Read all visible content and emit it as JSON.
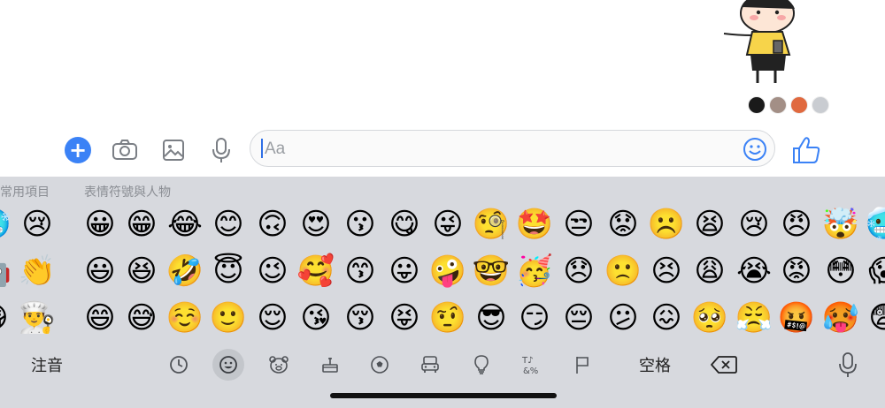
{
  "composer": {
    "placeholder": "Aa"
  },
  "keyboard": {
    "categories": [
      "常用項目",
      "表情符號與人物"
    ],
    "left_toggle": "注音",
    "space_label": "空格",
    "tabs": [
      "recent-clock-icon",
      "smileys-icon",
      "animals-icon",
      "food-icon",
      "activity-icon",
      "travel-icon",
      "objects-icon",
      "symbols-icon",
      "flags-icon"
    ],
    "frequent_rows": [
      [
        "😢"
      ],
      [
        "👏"
      ],
      [
        "👨‍🍳"
      ]
    ],
    "emoji_rows": [
      [
        "😀",
        "😁",
        "😂",
        "😊",
        "🙃",
        "😍",
        "😗",
        "😋",
        "😜",
        "🧐",
        "🤩",
        "😒",
        "😟",
        "☹️",
        "😫",
        "😢",
        "😠",
        "🤯",
        "🥶"
      ],
      [
        "😃",
        "😆",
        "🤣",
        "😇",
        "😉",
        "🥰",
        "😙",
        "😛",
        "🤪",
        "🤓",
        "🥳",
        "😞",
        "🙁",
        "😣",
        "😩",
        "😭",
        "😡",
        "😳",
        "😱"
      ],
      [
        "😄",
        "😅",
        "☺️",
        "🙂",
        "😌",
        "😘",
        "😚",
        "😝",
        "🤨",
        "😎",
        "😏",
        "😔",
        "😕",
        "😖",
        "🥺",
        "😤",
        "🤬",
        "🥵",
        "😨"
      ]
    ],
    "partial_left": [
      "🥶",
      "🤖",
      "😷"
    ],
    "colors": {
      "keyboard_bg": "#d7d9de",
      "accent": "#3b82f6"
    }
  }
}
